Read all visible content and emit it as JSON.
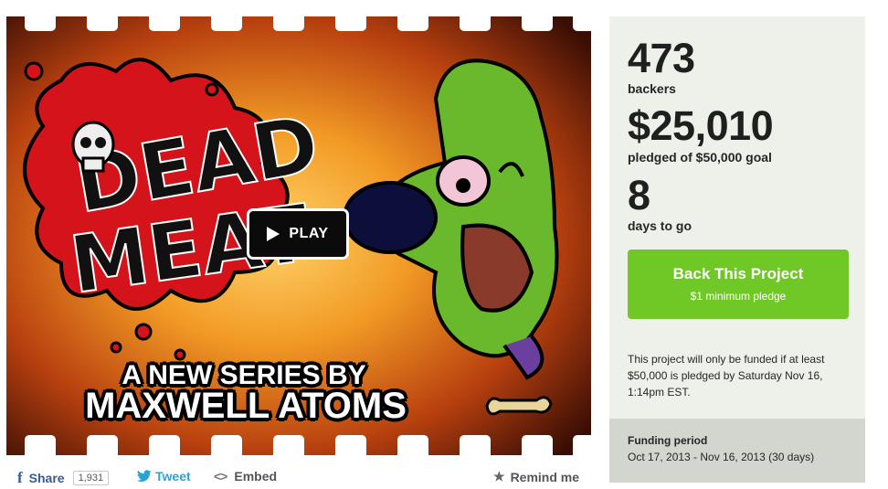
{
  "video": {
    "play_label": "PLAY",
    "headline_line1": "A NEW SERIES BY",
    "headline_line2": "MAXWELL ATOMS",
    "logo_text": "DEAD MEAT"
  },
  "share": {
    "facebook_label": "Share",
    "facebook_count": "1,931",
    "twitter_label": "Tweet",
    "embed_label": "Embed",
    "remind_label": "Remind me"
  },
  "stats": {
    "backers_count": "473",
    "backers_label": "backers",
    "pledged_amount": "$25,010",
    "pledged_label": "pledged of $50,000 goal",
    "days_count": "8",
    "days_label": "days to go"
  },
  "back_button": {
    "label": "Back This Project",
    "sublabel": "$1 minimum pledge"
  },
  "notice": "This project will only be funded if at least $50,000 is pledged by Saturday Nov 16, 1:14pm EST.",
  "funding": {
    "label": "Funding period",
    "value": "Oct 17, 2013 - Nov 16, 2013 (30 days)"
  },
  "colors": {
    "back_button": "#6fc826",
    "sidebar_bg": "#eef0ea",
    "funding_bg": "#d3d5cf",
    "facebook": "#3b5998",
    "twitter": "#2ba2d6"
  }
}
